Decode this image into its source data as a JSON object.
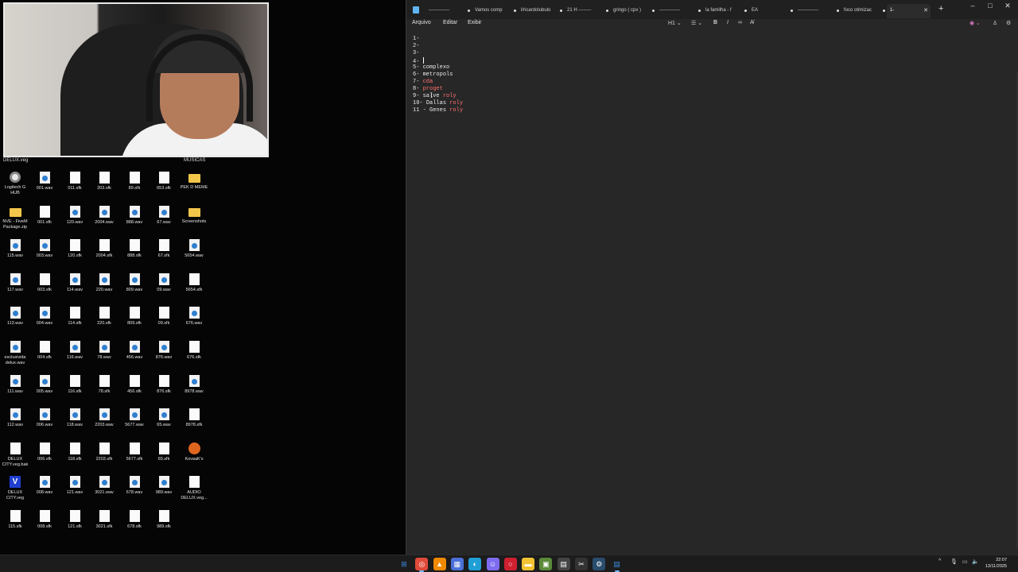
{
  "desktop": {
    "top_labels": {
      "left": "DELUX.veg",
      "right": "MUSICAS"
    },
    "icons": [
      {
        "label": "Logitech G HUB",
        "type": "gear"
      },
      {
        "label": "001.wav",
        "type": "wav"
      },
      {
        "label": "011.sfk",
        "type": "sfk"
      },
      {
        "label": "203.sfk",
        "type": "sfk"
      },
      {
        "label": "89.sfk",
        "type": "sfk"
      },
      {
        "label": "653.sfk",
        "type": "sfk"
      },
      {
        "label": "PEK D MEME",
        "type": "folder"
      },
      {
        "label": "NVE - FiveM Package.zip",
        "type": "folder"
      },
      {
        "label": "001.sfk",
        "type": "sfk"
      },
      {
        "label": "120.wav",
        "type": "wav"
      },
      {
        "label": "2004.wav",
        "type": "wav"
      },
      {
        "label": "888.wav",
        "type": "wav"
      },
      {
        "label": "67.wav",
        "type": "wav"
      },
      {
        "label": "Screenshots",
        "type": "folder"
      },
      {
        "label": "115.wav",
        "type": "wav"
      },
      {
        "label": "003.wav",
        "type": "wav"
      },
      {
        "label": "120.sfk",
        "type": "sfk"
      },
      {
        "label": "2004.sfk",
        "type": "sfk"
      },
      {
        "label": "888.sfk",
        "type": "sfk"
      },
      {
        "label": "67.sfk",
        "type": "sfk"
      },
      {
        "label": "5654.wav",
        "type": "wav"
      },
      {
        "label": "117.wav",
        "type": "wav"
      },
      {
        "label": "003.sfk",
        "type": "sfk"
      },
      {
        "label": "114.wav",
        "type": "wav"
      },
      {
        "label": "220.wav",
        "type": "wav"
      },
      {
        "label": "809.wav",
        "type": "wav"
      },
      {
        "label": "09.wav",
        "type": "wav"
      },
      {
        "label": "5654.sfk",
        "type": "sfk"
      },
      {
        "label": "113.wav",
        "type": "wav"
      },
      {
        "label": "004.wav",
        "type": "wav"
      },
      {
        "label": "114.sfk",
        "type": "sfk"
      },
      {
        "label": "220.sfk",
        "type": "sfk"
      },
      {
        "label": "809.sfk",
        "type": "sfk"
      },
      {
        "label": "09.sfk",
        "type": "sfk"
      },
      {
        "label": "676.wav",
        "type": "wav"
      },
      {
        "label": "exclusivida delux.wav",
        "type": "wav"
      },
      {
        "label": "004.sfk",
        "type": "sfk"
      },
      {
        "label": "116.wav",
        "type": "wav"
      },
      {
        "label": "78.wav",
        "type": "wav"
      },
      {
        "label": "456.wav",
        "type": "wav"
      },
      {
        "label": "876.wav",
        "type": "wav"
      },
      {
        "label": "676.sfk",
        "type": "sfk"
      },
      {
        "label": "111.wav",
        "type": "wav"
      },
      {
        "label": "005.wav",
        "type": "wav"
      },
      {
        "label": "116.sfk",
        "type": "sfk"
      },
      {
        "label": "78.sfk",
        "type": "sfk"
      },
      {
        "label": "456.sfk",
        "type": "sfk"
      },
      {
        "label": "876.sfk",
        "type": "sfk"
      },
      {
        "label": "8978.wav",
        "type": "wav"
      },
      {
        "label": "112.wav",
        "type": "wav"
      },
      {
        "label": "006.wav",
        "type": "wav"
      },
      {
        "label": "118.wav",
        "type": "wav"
      },
      {
        "label": "2203.wav",
        "type": "wav"
      },
      {
        "label": "5677.wav",
        "type": "wav"
      },
      {
        "label": "65.wav",
        "type": "wav"
      },
      {
        "label": "8978.sfk",
        "type": "sfk"
      },
      {
        "label": "DELUX CITY.veg.bak",
        "type": "sfk"
      },
      {
        "label": "006.sfk",
        "type": "sfk"
      },
      {
        "label": "118.sfk",
        "type": "sfk"
      },
      {
        "label": "2203.sfk",
        "type": "sfk"
      },
      {
        "label": "5677.sfk",
        "type": "sfk"
      },
      {
        "label": "65.sfk",
        "type": "sfk"
      },
      {
        "label": "KovaaK's",
        "type": "ko"
      },
      {
        "label": "DELUX CITY.veg",
        "type": "veg"
      },
      {
        "label": "008.wav",
        "type": "wav"
      },
      {
        "label": "121.wav",
        "type": "wav"
      },
      {
        "label": "3021.wav",
        "type": "wav"
      },
      {
        "label": "678.wav",
        "type": "wav"
      },
      {
        "label": "989.wav",
        "type": "wav"
      },
      {
        "label": "AUDIO DELUX.veg...",
        "type": "sfk"
      },
      {
        "label": "115.sfk",
        "type": "sfk"
      },
      {
        "label": "008.sfk",
        "type": "sfk"
      },
      {
        "label": "121.sfk",
        "type": "sfk"
      },
      {
        "label": "3021.sfk",
        "type": "sfk"
      },
      {
        "label": "678.sfk",
        "type": "sfk"
      },
      {
        "label": "989.sfk",
        "type": "sfk"
      }
    ]
  },
  "notepad": {
    "tabs": [
      {
        "label": "-------------"
      },
      {
        "label": "Vamos comp"
      },
      {
        "label": "l/ricardolubulo"
      },
      {
        "label": "21 H --------"
      },
      {
        "label": "gringo ( cpx )"
      },
      {
        "label": "-------------"
      },
      {
        "label": "la familha - f"
      },
      {
        "label": "EA"
      },
      {
        "label": "-------------"
      },
      {
        "label": "foco otimizac"
      },
      {
        "label": "1-",
        "active": true
      }
    ],
    "menus": [
      "Arquivo",
      "Editar",
      "Exibir"
    ],
    "heading_select": "H1",
    "lines": [
      {
        "num": "1-",
        "text": ""
      },
      {
        "num": "2-",
        "text": ""
      },
      {
        "num": "3-",
        "text": ""
      },
      {
        "num": "4-",
        "text": "",
        "caret": true
      },
      {
        "num": "5-",
        "text": "complexo",
        "red": ""
      },
      {
        "num": "6-",
        "text": "metropols",
        "red": ""
      },
      {
        "num": "7-",
        "text": "",
        "red": "cda"
      },
      {
        "num": "8-",
        "text": "",
        "red": "proget"
      },
      {
        "num": "9-",
        "text": "salve ",
        "red": "roly"
      },
      {
        "num": "10-",
        "text": "Dallas ",
        "red": "roly"
      },
      {
        "num": "11",
        "text": "- Genes ",
        "red": "roly"
      }
    ]
  },
  "taskbar": {
    "apps": [
      "windows",
      "chrome",
      "vlc",
      "calculator",
      "edge",
      "discord",
      "opera",
      "explorer",
      "minecraft",
      "app",
      "snipping",
      "steam",
      "notepad"
    ],
    "clock": {
      "time": "22:07",
      "date": "13/11/2025"
    }
  }
}
